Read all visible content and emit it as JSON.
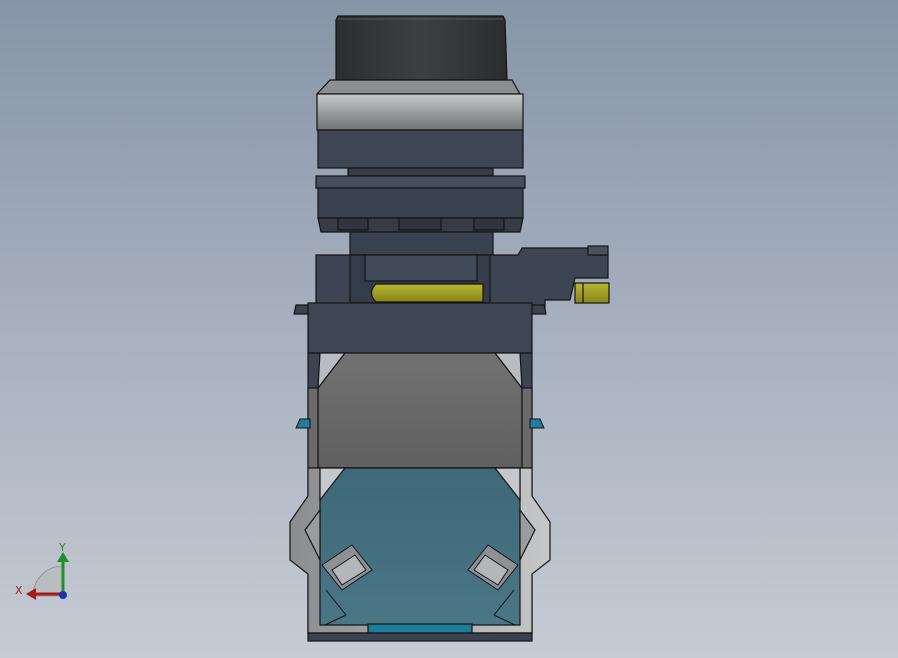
{
  "viewport": {
    "background_top": "#8795a8",
    "background_bottom": "#c6cbd3"
  },
  "model": {
    "description_hidden": "",
    "colors": {
      "cap": "#333538",
      "steel": "#a3a5a7",
      "housing_dark": "#3e4654",
      "terminal_yellow": "#9b9a1e",
      "block_gray": "#6b6b6b",
      "block_teal": "#426b7a",
      "clip_blue": "#1f7c9a",
      "outline": "#141414"
    }
  },
  "triad": {
    "x_label": "X",
    "y_label": "Y",
    "x_color": "#a61c1c",
    "y_color": "#1f8f2a",
    "z_color": "#2030b0"
  }
}
